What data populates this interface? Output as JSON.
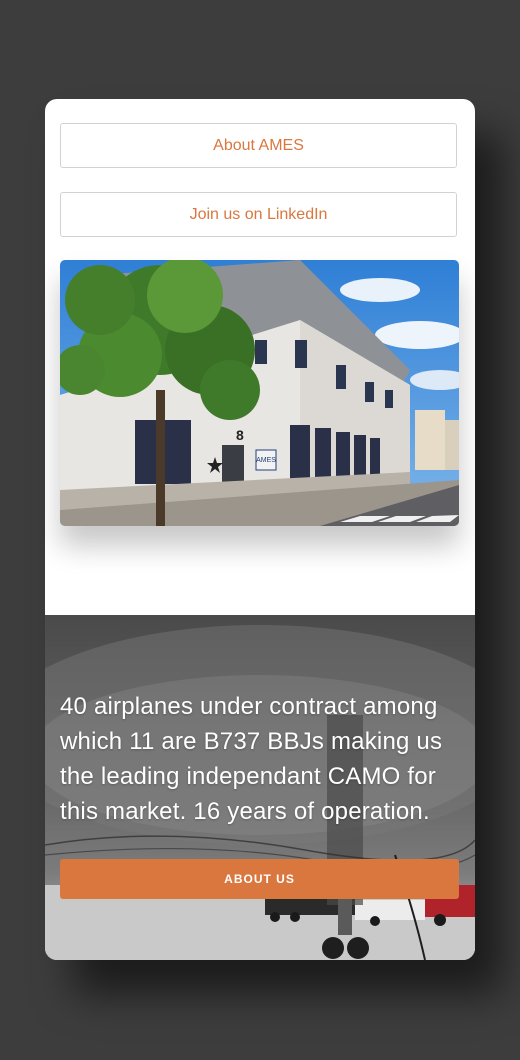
{
  "buttons": {
    "about_ames": "About AMES",
    "linkedin": "Join us on LinkedIn",
    "about_us": "ABOUT US"
  },
  "building_photo": {
    "sign": "AMES",
    "house_number": "8"
  },
  "hero": {
    "text": "40 airplanes under contract among which 11 are B737 BBJs making us the leading independant CAMO for this market. 16 years of operation."
  },
  "colors": {
    "accent": "#d9773f",
    "page_background": "#3d3d3d",
    "card_background": "#ffffff"
  }
}
